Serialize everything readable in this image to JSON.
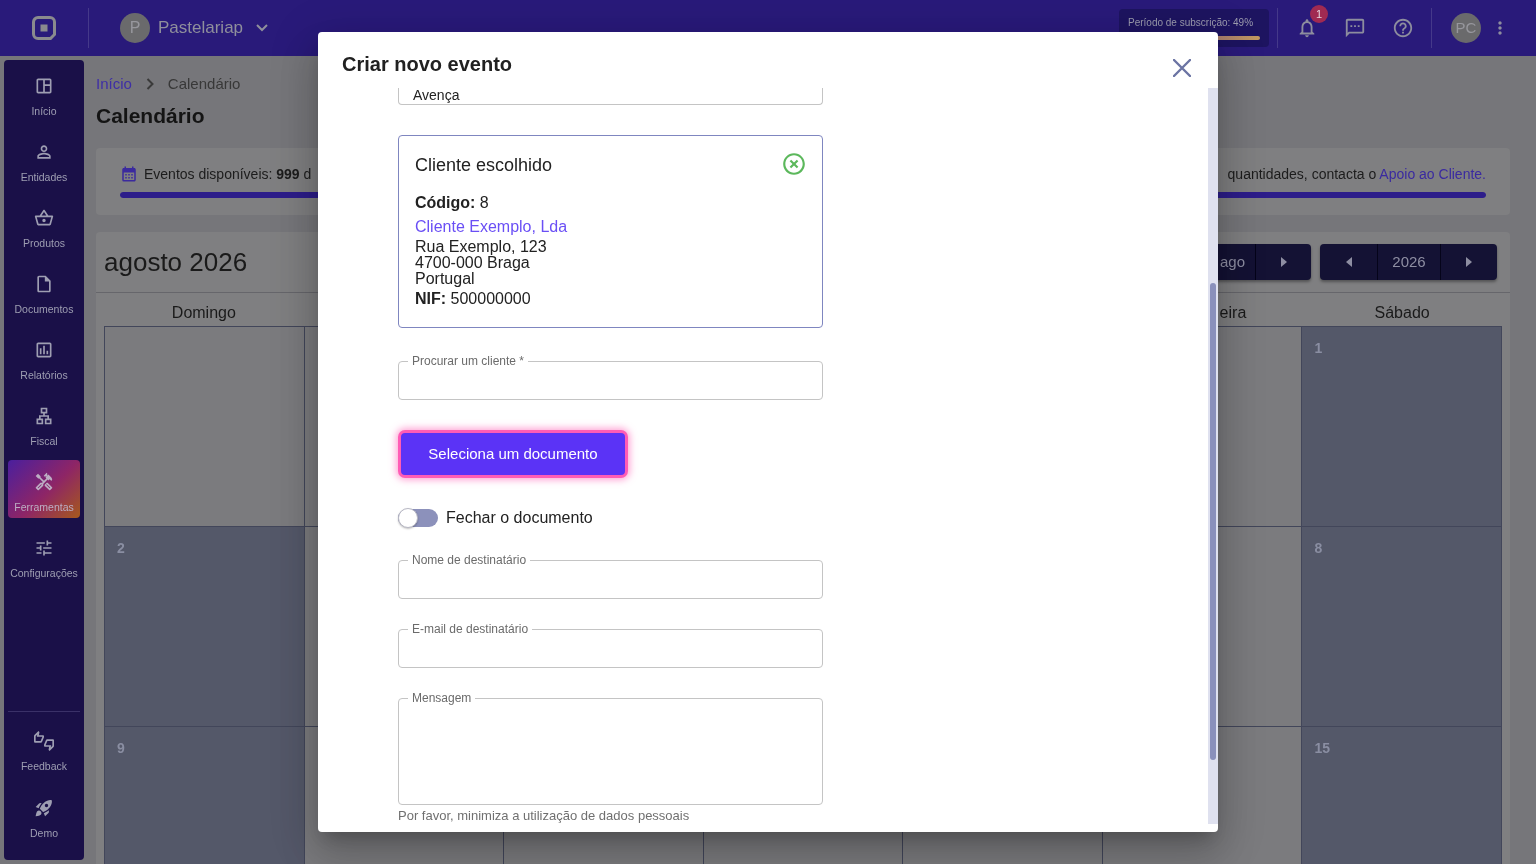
{
  "top_bar": {
    "company": {
      "initial": "P",
      "name": "Pastelariap"
    },
    "subscription": {
      "label": "Período de subscrição: 49%"
    },
    "notifications": {
      "count": "1"
    },
    "user": {
      "initials": "PC"
    }
  },
  "sidebar": {
    "items": [
      {
        "label": "Início",
        "selected": false
      },
      {
        "label": "Entidades",
        "selected": false
      },
      {
        "label": "Produtos",
        "selected": false
      },
      {
        "label": "Documentos",
        "selected": false
      },
      {
        "label": "Relatórios",
        "selected": false
      },
      {
        "label": "Fiscal",
        "selected": false
      },
      {
        "label": "Ferramentas",
        "selected": true
      },
      {
        "label": "Configurações",
        "selected": false
      }
    ],
    "bottom_items": [
      {
        "label": "Feedback",
        "selected": false
      },
      {
        "label": "Demo",
        "selected": false
      }
    ]
  },
  "breadcrumb": [
    {
      "label": "Início",
      "kind": "link"
    },
    {
      "label": "Calendário",
      "kind": "current"
    }
  ],
  "page_title": "Calendário",
  "events_info": {
    "text": "Eventos disponíveis: **999** d",
    "support_text": "quantidades, contacta o",
    "support_link": "Apoio ao Cliente.",
    "level": 1
  },
  "calendar": {
    "title": "agosto 2026",
    "month_nav": {
      "label": "ago"
    },
    "year_nav": {
      "label": "2026"
    },
    "weekdays": [
      "Domingo",
      "eira",
      "Sábado"
    ],
    "weeks": [
      {
        "days": [
          {
            "kind": "muted"
          },
          {
            "kind": "muted"
          },
          {
            "kind": "muted"
          },
          {
            "kind": "muted"
          },
          {
            "kind": "muted"
          },
          {
            "kind": "muted"
          },
          {
            "kind": "shaded",
            "number": "1"
          }
        ]
      },
      {
        "days": [
          {
            "kind": "shaded",
            "number": "2"
          },
          {
            "kind": "muted"
          },
          {
            "kind": "muted"
          },
          {
            "kind": "muted"
          },
          {
            "kind": "muted"
          },
          {
            "kind": "muted"
          },
          {
            "kind": "shaded",
            "number": "8"
          }
        ]
      },
      {
        "days": [
          {
            "kind": "shaded",
            "number": "9"
          },
          {
            "kind": "muted"
          },
          {
            "kind": "muted"
          },
          {
            "kind": "muted"
          },
          {
            "kind": "muted"
          },
          {
            "kind": "muted"
          },
          {
            "kind": "shaded",
            "number": "15"
          }
        ]
      }
    ]
  },
  "dialog": {
    "title": "Criar novo evento",
    "top_field": {
      "value": "Avença"
    },
    "chosen_client": {
      "title": "Cliente escolhido",
      "code": "**Código:** 8",
      "name": "Cliente Exemplo, Lda",
      "address": [
        "Rua Exemplo, 123",
        "4700-000 Braga",
        "Portugal"
      ],
      "nif": "**NIF:** 500000000"
    },
    "client_search": {
      "label": "Procurar um cliente *"
    },
    "select_document_button": {
      "label": "Seleciona um documento",
      "focused": true
    },
    "close_document_toggle": {
      "label": "Fechar o documento",
      "on": false
    },
    "recipient_name": {
      "label": "Nome de destinatário"
    },
    "recipient_email": {
      "label": "E-mail de destinatário"
    },
    "message": {
      "label": "Mensagem",
      "hint": "Por favor, minimiza a utilização de dados pessoais"
    }
  }
}
